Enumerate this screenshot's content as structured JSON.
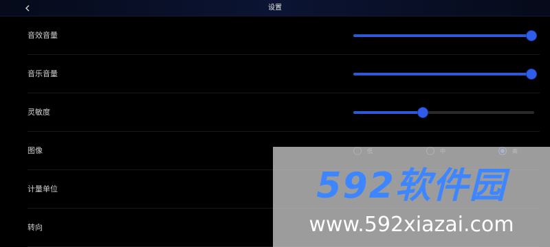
{
  "header": {
    "title": "设置",
    "back_icon": "chevron-left-icon"
  },
  "settings": {
    "sound_effect_volume": {
      "label": "音效音量",
      "value": 1.0
    },
    "music_volume": {
      "label": "音乐音量",
      "value": 1.0
    },
    "sensitivity": {
      "label": "灵敏度",
      "value": 0.38
    },
    "graphics": {
      "label": "图像",
      "options": [
        "低",
        "中",
        "高"
      ],
      "selected": "高"
    },
    "units": {
      "label": "计量单位"
    },
    "steering": {
      "label": "转向"
    }
  },
  "watermark": {
    "logo": "592软件园",
    "url": "www.592xiazai.com"
  },
  "colors": {
    "accent": "#2f58d6",
    "header_bg": "#0b1433",
    "background": "#000000"
  }
}
